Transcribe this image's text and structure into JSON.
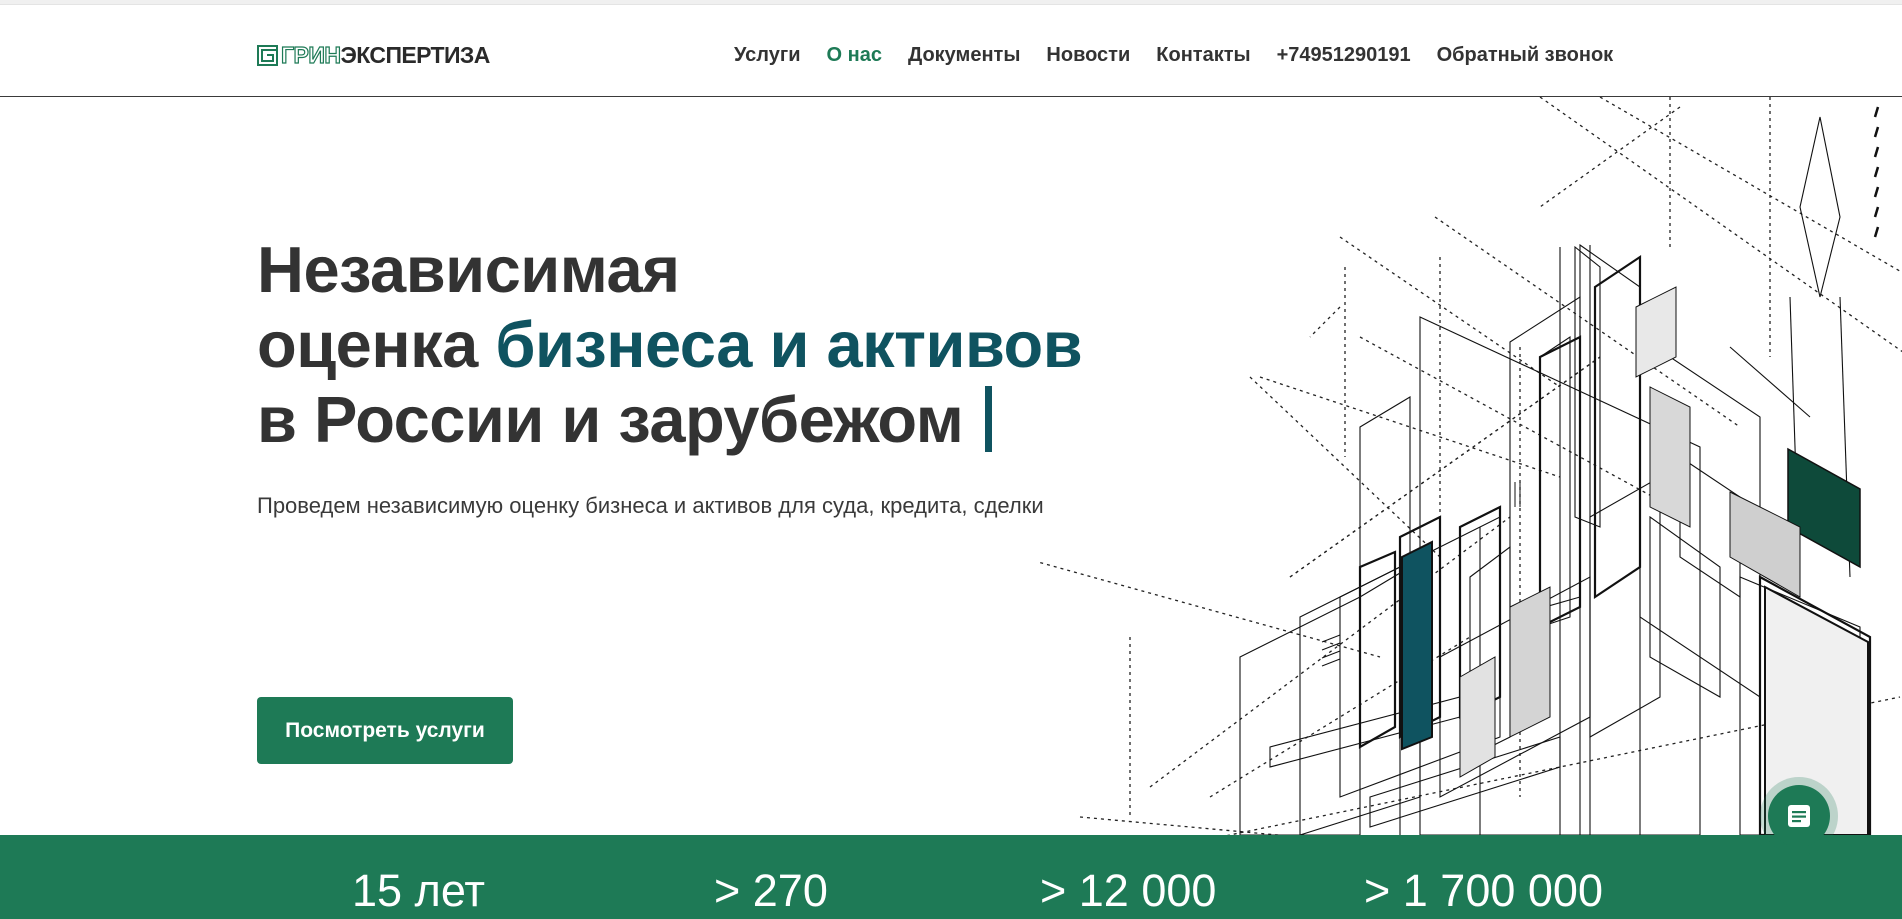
{
  "header": {
    "logo": {
      "part1": "ГРИН",
      "part2": "ЭКСПЕРТИЗА"
    },
    "nav": [
      {
        "label": "Услуги",
        "active": false
      },
      {
        "label": "О нас",
        "active": true
      },
      {
        "label": "Документы",
        "active": false
      },
      {
        "label": "Новости",
        "active": false
      },
      {
        "label": "Контакты",
        "active": false
      },
      {
        "label": "+74951290191",
        "active": false
      },
      {
        "label": "Обратный звонок",
        "active": false
      }
    ]
  },
  "hero": {
    "line1": "Независимая",
    "line2_plain": "оценка ",
    "line2_accent": "бизнеса и активов",
    "line3": "в России и зарубежом",
    "subtitle": "Проведем независимую оценку бизнеса и активов для суда, кредита, сделки",
    "cta_label": "Посмотреть услуги"
  },
  "stats": [
    "15 лет",
    "> 270",
    "> 12 000",
    "> 1 700 000"
  ],
  "colors": {
    "brand_green": "#1e7a56",
    "accent_teal": "#0f5360",
    "text_dark": "#333333",
    "dark_green_block": "#0e4a3a"
  },
  "icons": {
    "chat": "chat-document-icon",
    "logo_mark": "logo-mark-icon"
  }
}
